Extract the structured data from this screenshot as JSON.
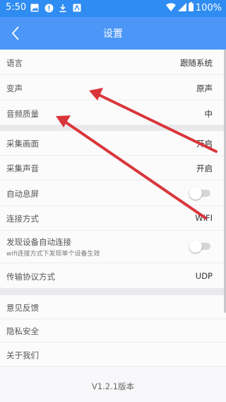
{
  "status_bar": {
    "time": "5:50",
    "battery": "100%",
    "left_icons": [
      "image-icon",
      "alert-icon",
      "download-icon",
      "app-icon"
    ],
    "right_icons": [
      "wifi-icon",
      "signal-icon",
      "battery-icon"
    ]
  },
  "header": {
    "title": "设置",
    "back_icon": "chevron-left-icon"
  },
  "sections": {
    "group1": [
      {
        "label": "语言",
        "value": "跟随系统"
      },
      {
        "label": "变声",
        "value": "原声"
      },
      {
        "label": "音频质量",
        "value": "中"
      }
    ],
    "group2": [
      {
        "label": "采集画面",
        "value": "开启"
      },
      {
        "label": "采集声音",
        "value": "开启"
      },
      {
        "label": "自动息屏",
        "toggle": false
      },
      {
        "label": "连接方式",
        "value": "WIFI"
      },
      {
        "label": "发现设备自动连接",
        "sub": "wifi连接方式下发现单个设备生效",
        "toggle": false
      },
      {
        "label": "传输协议方式",
        "value": "UDP"
      }
    ],
    "group3": [
      {
        "label": "意见反馈"
      },
      {
        "label": "隐私安全"
      },
      {
        "label": "关于我们"
      }
    ]
  },
  "version": "V1.2.1版本",
  "colors": {
    "primary": "#4b96f7",
    "status_bar": "#2f8cf2",
    "annotation_arrow": "#d9363b"
  }
}
